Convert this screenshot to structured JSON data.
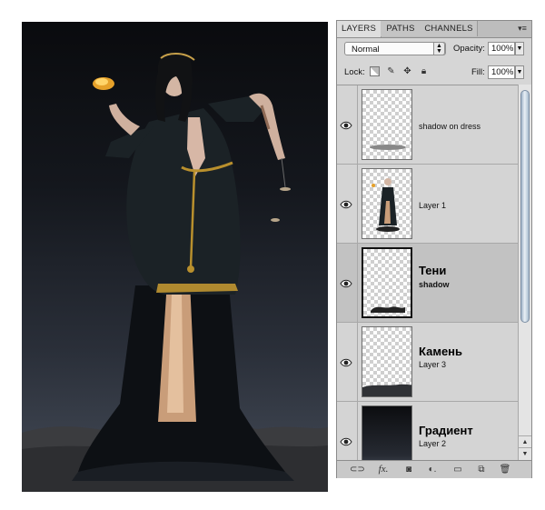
{
  "panel": {
    "tabs": [
      "LAYERS",
      "PATHS",
      "CHANNELS"
    ],
    "active_tab": "LAYERS",
    "blend_mode": "Normal",
    "opacity_label": "Opacity:",
    "opacity_value": "100%",
    "lock_label": "Lock:",
    "fill_label": "Fill:",
    "fill_value": "100%"
  },
  "layers": [
    {
      "name": "shadow on dress",
      "visible": true,
      "selected": false
    },
    {
      "name": "Layer 1",
      "visible": true,
      "selected": false
    },
    {
      "title": "Тени",
      "name": "shadow",
      "visible": true,
      "selected": true
    },
    {
      "title": "Камень",
      "name": "Layer 3",
      "visible": true,
      "selected": false
    },
    {
      "title": "Градиент",
      "name": "Layer 2",
      "visible": true,
      "selected": false
    }
  ],
  "icons": {
    "panel_menu": "panel-menu-icon",
    "lock": [
      "lock-transparency-icon",
      "lock-pixels-icon",
      "lock-position-icon",
      "lock-all-icon"
    ],
    "bottom": [
      "link-layers-icon",
      "fx-icon",
      "layer-mask-icon",
      "adjustment-layer-icon",
      "new-group-icon",
      "new-layer-icon",
      "trash-icon"
    ]
  },
  "colors": {
    "panel_bg": "#d6d6d6",
    "selected_row": "#c2c2c2",
    "canvas_top": "#0a0b0e",
    "canvas_bottom": "#454c58"
  }
}
